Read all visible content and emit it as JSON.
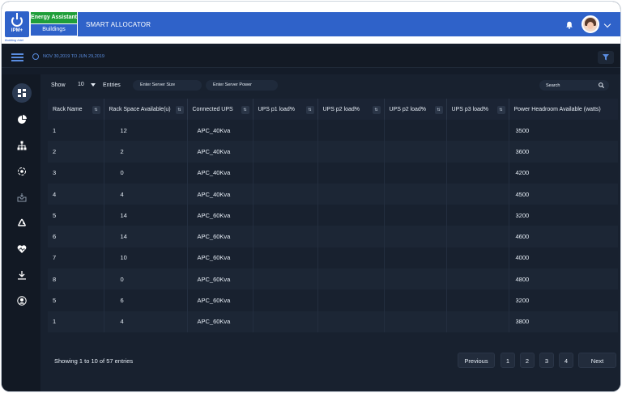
{
  "header": {
    "logo_text": "IPM+",
    "logo_subtitle": "Building Intel",
    "tab_energy": "Energy Assistant",
    "tab_buildings": "Buildings",
    "app_title": "SMART ALLOCATOR"
  },
  "subbar": {
    "date_range": "NOV 30,2019 TO JUN 29,2019"
  },
  "sidebar": {
    "items": [
      "dashboard-icon",
      "pie-chart-icon",
      "hierarchy-icon",
      "allocator-icon",
      "inbox-icon",
      "recycle-icon",
      "health-icon",
      "download-icon",
      "user-icon"
    ]
  },
  "controls": {
    "show_label": "Show",
    "entries_value": "10",
    "entries_label": "Entries",
    "server_size_placeholder": "Enter Server Size",
    "server_power_placeholder": "Enter Server Power",
    "search_placeholder": "Search"
  },
  "table": {
    "headers": [
      "Rack Name",
      "Rack Space Available(u)",
      "Connected UPS",
      "UPS p1 load%",
      "UPS p2 load%",
      "UPS p2 load%",
      "UPS p3 load%",
      "Power Headroom Available (watts)"
    ],
    "rows": [
      [
        "1",
        "12",
        "APC_40Kva",
        "",
        "",
        "",
        "",
        "3500"
      ],
      [
        "2",
        "2",
        "APC_40Kva",
        "",
        "",
        "",
        "",
        "3600"
      ],
      [
        "3",
        "0",
        "APC_40Kva",
        "",
        "",
        "",
        "",
        "4200"
      ],
      [
        "4",
        "4",
        "APC_40Kva",
        "",
        "",
        "",
        "",
        "4500"
      ],
      [
        "5",
        "14",
        "APC_60Kva",
        "",
        "",
        "",
        "",
        "3200"
      ],
      [
        "6",
        "14",
        "APC_60Kva",
        "",
        "",
        "",
        "",
        "4600"
      ],
      [
        "7",
        "10",
        "APC_60Kva",
        "",
        "",
        "",
        "",
        "4000"
      ],
      [
        "8",
        "0",
        "APC_60Kva",
        "",
        "",
        "",
        "",
        "4800"
      ],
      [
        "5",
        "6",
        "APC_60Kva",
        "",
        "",
        "",
        "",
        "3200"
      ],
      [
        "1",
        "4",
        "APC_60Kva",
        "",
        "",
        "",
        "",
        "3800"
      ]
    ]
  },
  "footer": {
    "info": "Showing 1 to 10 of 57 entries",
    "previous": "Previous",
    "pages": [
      "1",
      "2",
      "3",
      "4"
    ],
    "next": "Next"
  },
  "colors": {
    "brand_blue": "#2f62c9",
    "energy_green": "#1f9e3a",
    "background": "#141c29"
  }
}
